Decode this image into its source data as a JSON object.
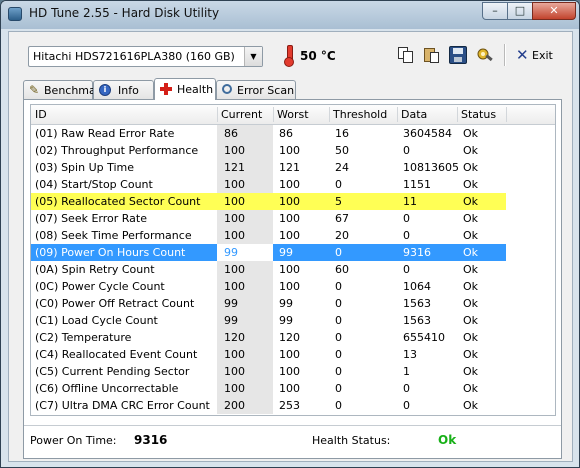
{
  "window": {
    "title": "HD Tune 2.55 - Hard Disk Utility",
    "min": "–",
    "max": "□",
    "close": "✕"
  },
  "toolbar": {
    "drive": "Hitachi HDS721616PLA380 (160 GB)",
    "temperature": "50 °C",
    "icons": [
      "copy-icon",
      "paste-icon",
      "save-icon",
      "options-icon"
    ],
    "exit_label": "Exit",
    "exit_mnemonic_x": "✕"
  },
  "tabs": [
    {
      "label": "Benchmark",
      "icon": "benchmark-icon"
    },
    {
      "label": "Info",
      "icon": "info-icon"
    },
    {
      "label": "Health",
      "icon": "health-cross-icon"
    },
    {
      "label": "Error Scan",
      "icon": "magnifier-icon"
    }
  ],
  "table": {
    "headers": {
      "id": "ID",
      "current": "Current",
      "worst": "Worst",
      "threshold": "Threshold",
      "data": "Data",
      "status": "Status"
    },
    "rows": [
      {
        "id": "(01) Raw Read Error Rate",
        "current": "86",
        "worst": "86",
        "threshold": "16",
        "data": "3604584",
        "status": "Ok"
      },
      {
        "id": "(02) Throughput Performance",
        "current": "100",
        "worst": "100",
        "threshold": "50",
        "data": "0",
        "status": "Ok"
      },
      {
        "id": "(03) Spin Up Time",
        "current": "121",
        "worst": "121",
        "threshold": "24",
        "data": "10813605",
        "status": "Ok"
      },
      {
        "id": "(04) Start/Stop Count",
        "current": "100",
        "worst": "100",
        "threshold": "0",
        "data": "1151",
        "status": "Ok"
      },
      {
        "id": "(05) Reallocated Sector Count",
        "current": "100",
        "worst": "100",
        "threshold": "5",
        "data": "11",
        "status": "Ok"
      },
      {
        "id": "(07) Seek Error Rate",
        "current": "100",
        "worst": "100",
        "threshold": "67",
        "data": "0",
        "status": "Ok"
      },
      {
        "id": "(08) Seek Time Performance",
        "current": "100",
        "worst": "100",
        "threshold": "20",
        "data": "0",
        "status": "Ok"
      },
      {
        "id": "(09) Power On Hours Count",
        "current": "99",
        "worst": "99",
        "threshold": "0",
        "data": "9316",
        "status": "Ok"
      },
      {
        "id": "(0A) Spin Retry Count",
        "current": "100",
        "worst": "100",
        "threshold": "60",
        "data": "0",
        "status": "Ok"
      },
      {
        "id": "(0C) Power Cycle Count",
        "current": "100",
        "worst": "100",
        "threshold": "0",
        "data": "1064",
        "status": "Ok"
      },
      {
        "id": "(C0) Power Off Retract Count",
        "current": "99",
        "worst": "99",
        "threshold": "0",
        "data": "1563",
        "status": "Ok"
      },
      {
        "id": "(C1) Load Cycle Count",
        "current": "99",
        "worst": "99",
        "threshold": "0",
        "data": "1563",
        "status": "Ok"
      },
      {
        "id": "(C2) Temperature",
        "current": "120",
        "worst": "120",
        "threshold": "0",
        "data": "655410",
        "status": "Ok"
      },
      {
        "id": "(C4) Reallocated Event Count",
        "current": "100",
        "worst": "100",
        "threshold": "0",
        "data": "13",
        "status": "Ok"
      },
      {
        "id": "(C5) Current Pending Sector",
        "current": "100",
        "worst": "100",
        "threshold": "0",
        "data": "1",
        "status": "Ok"
      },
      {
        "id": "(C6) Offline Uncorrectable",
        "current": "100",
        "worst": "100",
        "threshold": "0",
        "data": "0",
        "status": "Ok"
      },
      {
        "id": "(C7) Ultra DMA CRC Error Count",
        "current": "200",
        "worst": "253",
        "threshold": "0",
        "data": "0",
        "status": "Ok"
      }
    ]
  },
  "footer": {
    "power_on_label": "Power On Time:",
    "power_on_value": "9316",
    "health_label": "Health Status:",
    "health_value": "Ok"
  },
  "colors": {
    "highlight_yellow": "#ffff55",
    "selection_blue": "#3399ff",
    "health_ok_green": "#18b018"
  }
}
